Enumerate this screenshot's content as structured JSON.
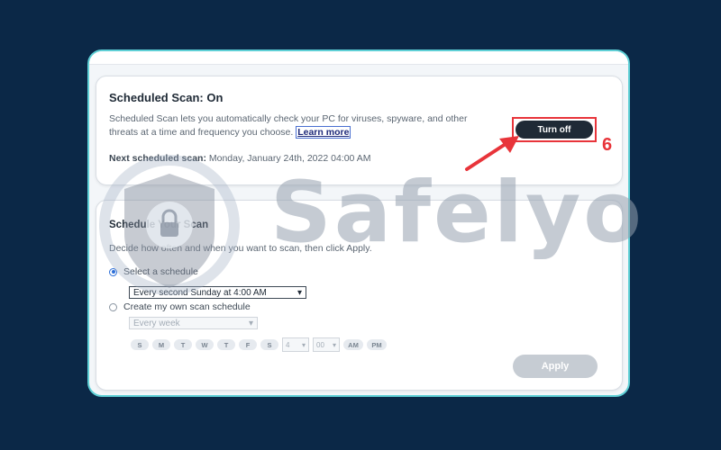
{
  "scheduled_card": {
    "title": "Scheduled Scan: On",
    "description": "Scheduled Scan lets you automatically check your PC for viruses, spyware, and other threats at a time and frequency you choose.",
    "learn_more": "Learn more",
    "next_label": "Next scheduled scan:",
    "next_value": "Monday, January 24th, 2022 04:00 AM",
    "turn_off_label": "Turn off"
  },
  "annotation": {
    "step_number": "6",
    "accent_color": "#e8343a"
  },
  "schedule_card": {
    "title": "Schedule Your Scan",
    "description": "Decide how often and when you want to scan, then click Apply.",
    "option_preset": {
      "label": "Select a schedule",
      "selected": true,
      "value": "Every second Sunday at 4:00 AM"
    },
    "option_custom": {
      "label": "Create my own scan schedule",
      "selected": false,
      "frequency": "Every week"
    },
    "days": [
      "S",
      "M",
      "T",
      "W",
      "T",
      "F",
      "S"
    ],
    "hour": "4",
    "minute": "00",
    "am_label": "AM",
    "pm_label": "PM",
    "apply_label": "Apply"
  },
  "watermark": {
    "text": "Safelyo"
  },
  "colors": {
    "background": "#0b2847",
    "frame_border": "#5fd0d6",
    "button_dark": "#1f2a36",
    "radio_accent": "#2d6fd8"
  }
}
